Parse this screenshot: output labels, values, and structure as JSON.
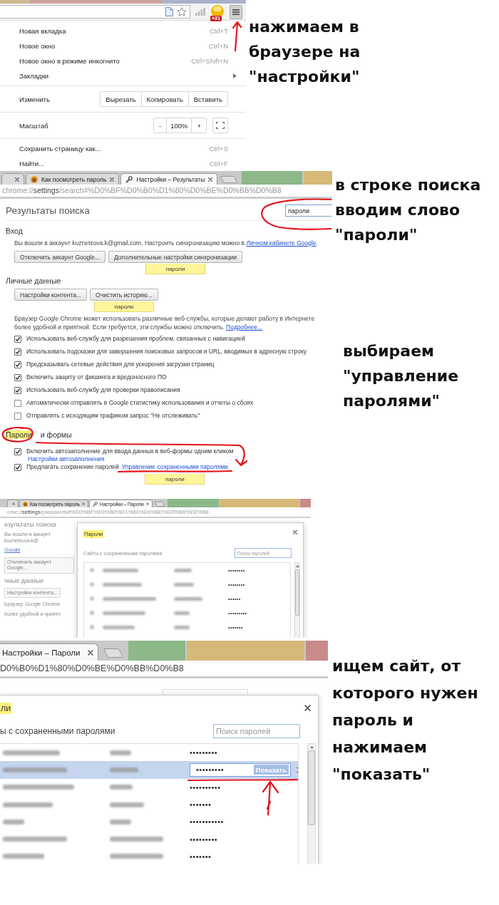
{
  "panels": [
    {
      "kind": "menu",
      "toolbar": {
        "badge": "+31",
        "menu_button": {
          "open": true
        }
      },
      "menu": [
        {
          "kind": "command",
          "label": "Новая вкладка",
          "shortcut": "Ctrl+T"
        },
        {
          "kind": "command",
          "label": "Новое окно",
          "shortcut": "Ctrl+N"
        },
        {
          "kind": "command",
          "label": "Новое окно в режиме инкогнито",
          "shortcut": "Ctrl+Shift+N"
        },
        {
          "kind": "submenu",
          "label": "Закладки"
        },
        {
          "kind": "divider"
        },
        {
          "kind": "edit",
          "label": "Изменить",
          "buttons": [
            "Вырезать",
            "Копировать",
            "Вставить"
          ]
        },
        {
          "kind": "divider"
        },
        {
          "kind": "zoom",
          "label": "Масштаб",
          "minus": "-",
          "value": "100%",
          "plus": "+"
        },
        {
          "kind": "divider"
        },
        {
          "kind": "command",
          "label": "Сохранить страницу как...",
          "shortcut": "Ctrl+S"
        },
        {
          "kind": "command",
          "label": "Найти...",
          "shortcut": "Ctrl+F"
        }
      ],
      "captions": [
        {
          "lines": [
            "нажимаем в",
            "браузере на",
            "\"настройки\""
          ]
        }
      ]
    },
    {
      "kind": "settings",
      "tabs": [
        {
          "kind": "stub",
          "selected": false
        },
        {
          "kind": "web",
          "title": "Как посмотреть пароль",
          "selected": false
        },
        {
          "kind": "settings",
          "title": "Настройки – Результаты",
          "selected": true
        }
      ],
      "url": {
        "scheme": "chrome://",
        "host": "settings",
        "path": "/search#%D0%BF%D0%B0%D1%80%D0%BE%D0%BB%D0%B8"
      },
      "title": "Результаты поиска",
      "search": {
        "value": "пароли"
      },
      "sections": [
        {
          "heading": "Вход",
          "blocks": [
            {
              "kind": "text",
              "text": "Вы вошли в аккаунт kuznetsova.k@gmail.com. Настроить синхронизацию можно в",
              "link": "Личном кабинете Google",
              "after": "."
            },
            {
              "kind": "buttons",
              "buttons": [
                "Отключить аккаунт Google...",
                "Дополнительные настройки синхронизации"
              ],
              "bubble": "пароли"
            }
          ]
        },
        {
          "heading": "Личные данные",
          "blocks": [
            {
              "kind": "buttons",
              "buttons": [
                "Настройки контента...",
                "Очистить историю..."
              ],
              "bubble": "пароли"
            },
            {
              "kind": "text",
              "text": "Браузер Google Chrome может использовать различные веб-службы, которые делают работу в Интернете более удобной и приятной. Если требуется, эти службы можно отключить.",
              "link": "Подробнее..."
            },
            {
              "kind": "checkbox",
              "label": "Использовать веб-службу для разрешения проблем, связанных с навигацией",
              "checked": true
            },
            {
              "kind": "checkbox",
              "label": "Использовать подсказки для завершения поисковых запросов и URL, вводимых в адресную строку",
              "checked": true
            },
            {
              "kind": "checkbox",
              "label": "Предсказывать сетевые действия для ускорения загрузки страниц",
              "checked": true
            },
            {
              "kind": "checkbox",
              "label": "Включить защиту от фишинга и вредоносного ПО",
              "checked": true
            },
            {
              "kind": "checkbox",
              "label": "Использовать веб-службу для проверки правописания",
              "checked": true
            },
            {
              "kind": "checkbox",
              "label": "Автоматически отправлять в Google статистику использования и отчеты о сбоях",
              "checked": false
            },
            {
              "kind": "checkbox",
              "label": "Отправлять с исходящим трафиком запрос \"Не отслеживать\"",
              "checked": false
            }
          ]
        },
        {
          "search_match": "Пароли",
          "heading": "и формы",
          "blocks": [
            {
              "kind": "checkbox",
              "label": "Включить автозаполнение для ввода данных в веб-формы одним кликом",
              "checked": true,
              "sublink": "Настройки автозаполнения"
            },
            {
              "kind": "checkbox",
              "label": "Предлагать сохранение паролей",
              "checked": true,
              "link": "Управление сохраненными паролями",
              "bubble": "пароли"
            }
          ]
        }
      ],
      "captions": [
        {
          "lines": [
            "в строке поиска",
            "вводим слово",
            "\"пароли\""
          ]
        },
        {
          "lines": [
            "выбираем",
            "\"управление",
            "паролями\""
          ]
        }
      ]
    },
    {
      "kind": "passwords_overview",
      "tabs": [
        {
          "kind": "stub",
          "selected": false
        },
        {
          "kind": "web",
          "title": "Как посмотреть пароль",
          "selected": false
        },
        {
          "kind": "settings",
          "title": "Настройки – Пароли",
          "selected": true
        }
      ],
      "url": {
        "scheme": "ome://",
        "host": "settings",
        "path": "/passwords#%D0%BF%D0%B0%D1%80%D0%BE%D0%BB%D0%B8"
      },
      "background": [
        {
          "kind": "heading",
          "text": "езультаты поиска"
        },
        {
          "kind": "text",
          "text": "Вы вошли в аккаунт kuznetsova.k@"
        },
        {
          "kind": "link",
          "text": "Google"
        },
        {
          "kind": "button",
          "text": "Отключить аккаунт Google..."
        },
        {
          "kind": "heading",
          "text": "чные данные"
        },
        {
          "kind": "button",
          "text": "Настройки контента..."
        },
        {
          "kind": "text",
          "text": "Браузер Google Chrome"
        },
        {
          "kind": "text",
          "text": "более удобной и приятн"
        }
      ],
      "dialog": {
        "title": {
          "text": "Пароли",
          "highlight": true
        },
        "heading": "Сайты с сохраненными паролями",
        "search_placeholder": "Поиск паролей",
        "rows": [
          {
            "password": "••••••••",
            "selected": false
          },
          {
            "password": "••••••••",
            "selected": false
          },
          {
            "password": "••••••",
            "selected": false
          },
          {
            "password": "•••••••••",
            "selected": false
          },
          {
            "password": "•••••••",
            "selected": false
          }
        ]
      }
    },
    {
      "kind": "passwords_closeup",
      "tabs": [
        {
          "kind": "page",
          "title": "Настройки – Пароли",
          "selected": true
        }
      ],
      "url": {
        "path": "D0%B0%D1%80%D0%BE%D0%BB%D0%B8"
      },
      "background": [
        {
          "kind": "search_field"
        }
      ],
      "dialog": {
        "title": {
          "text": "ли",
          "highlight": true
        },
        "heading": "ы с сохраненными паролями",
        "search_placeholder": "Поиск паролей",
        "rows": [
          {
            "password": "•••••••••",
            "selected": false
          },
          {
            "password": "•••••••••",
            "selected": true,
            "show_button": "Показать"
          },
          {
            "password": "••••••••••",
            "selected": false
          },
          {
            "password": "•••••••",
            "selected": false
          },
          {
            "password": "•••••••••••",
            "selected": false
          },
          {
            "password": "•••••••••",
            "selected": false
          },
          {
            "password": "•••••••",
            "selected": false
          }
        ]
      },
      "captions": [
        {
          "lines": [
            "ищем сайт, от",
            "которого нужен",
            "пароль и",
            "нажимаем",
            "\"показать\""
          ]
        }
      ]
    }
  ]
}
